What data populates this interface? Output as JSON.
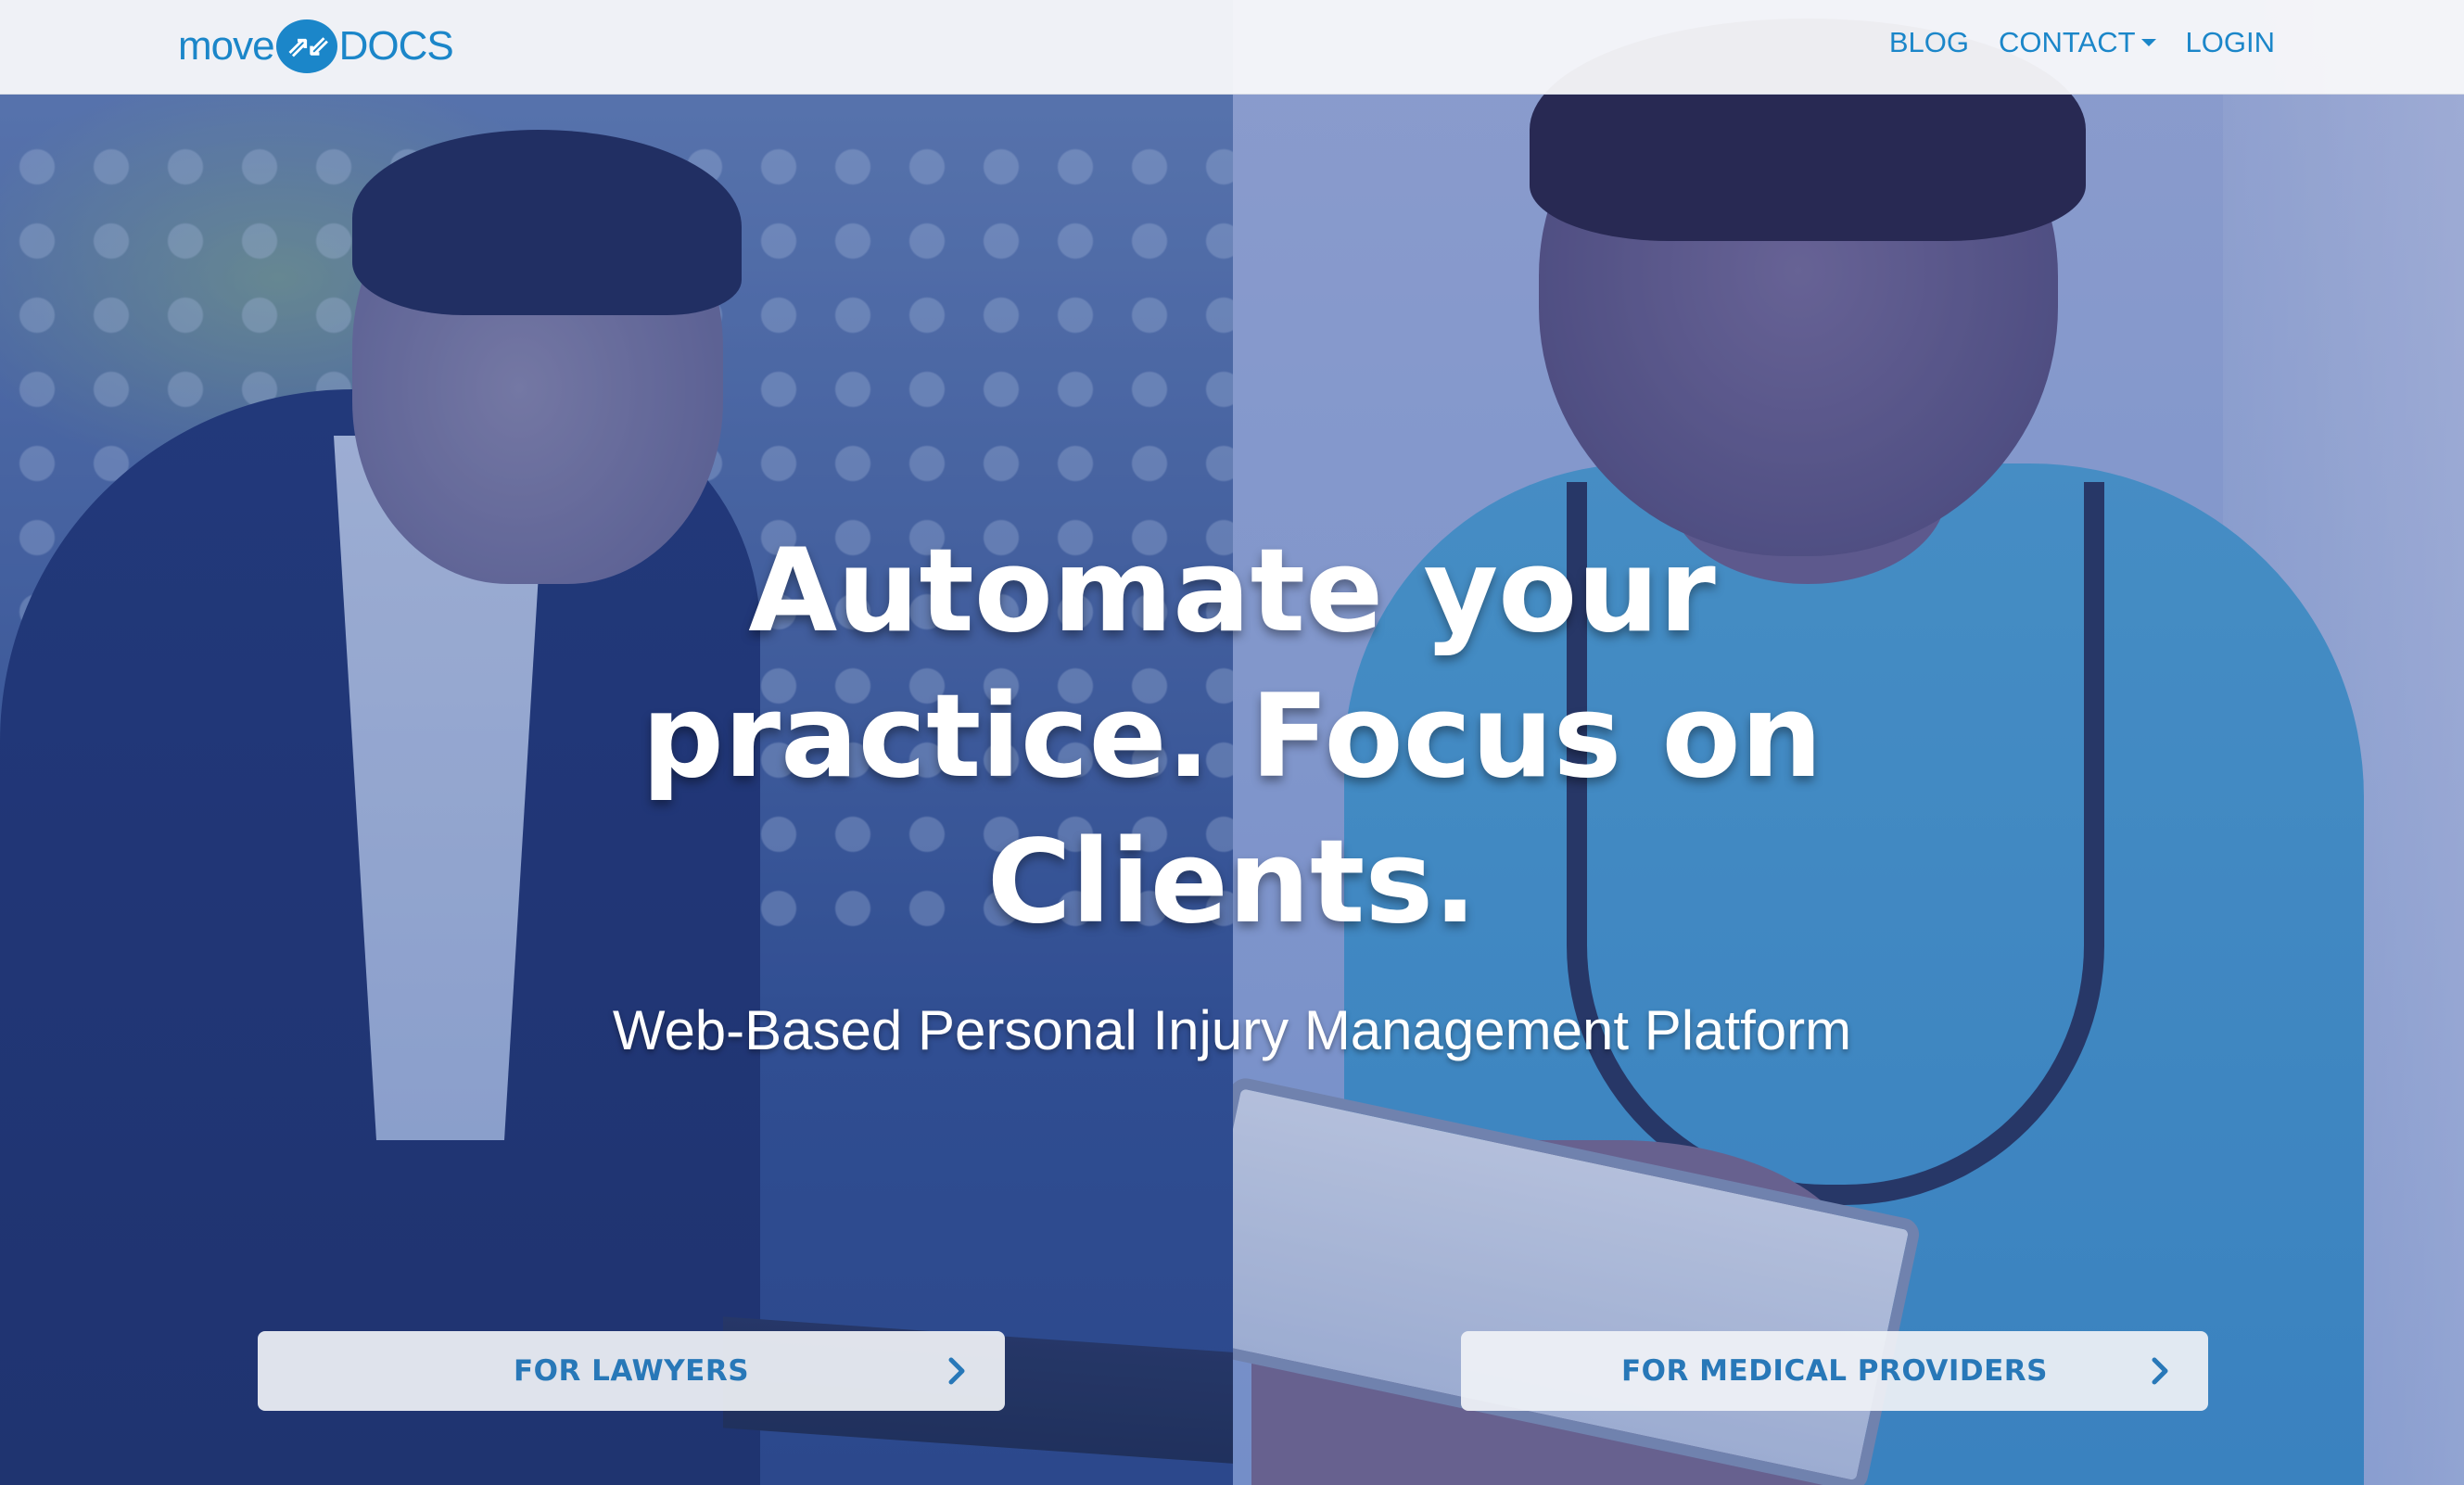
{
  "nav": {
    "logo": {
      "left": "move",
      "badge": "⇗⇙",
      "right": "DOCS"
    },
    "links": {
      "blog": "BLOG",
      "contact": "CONTACT",
      "login": "LOGIN"
    }
  },
  "hero": {
    "title": "Automate your practice. Focus on Clients.",
    "subtitle": "Web-Based Personal Injury Management Platform"
  },
  "ctas": {
    "lawyers": "FOR LAWYERS",
    "medical": "FOR MEDICAL PROVIDERS"
  },
  "colors": {
    "brand": "#1b86c9",
    "cta_text": "#2878b8"
  }
}
